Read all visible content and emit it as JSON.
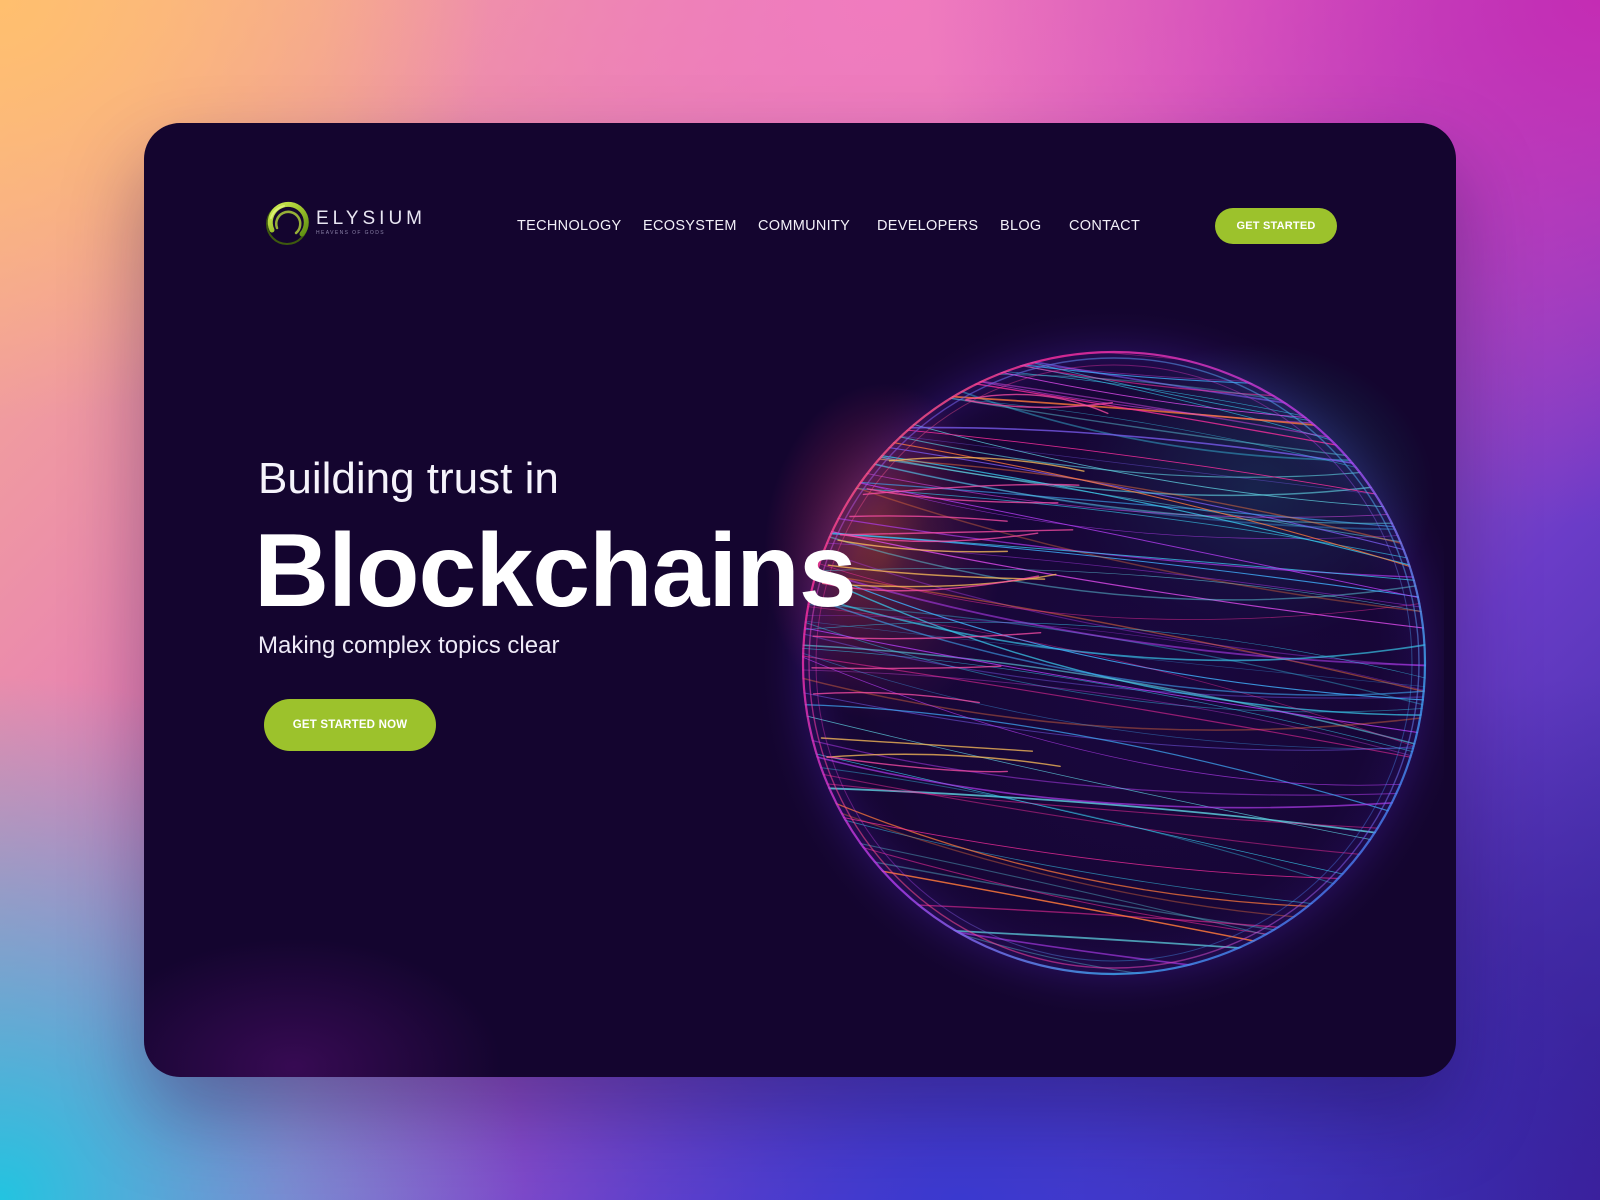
{
  "brand": {
    "name": "ELYSIUM",
    "tagline": "HEAVENS OF GODS",
    "accent_color": "#9cc22c"
  },
  "nav": {
    "items": [
      {
        "label": "TECHNOLOGY"
      },
      {
        "label": "ECOSYSTEM"
      },
      {
        "label": "COMMUNITY"
      },
      {
        "label": "DEVELOPERS"
      },
      {
        "label": "BLOG"
      },
      {
        "label": "CONTACT"
      }
    ],
    "cta_label": "GET STARTED"
  },
  "hero": {
    "pretitle": "Building trust in",
    "title": "Blockchains",
    "subtitle": "Making complex topics clear",
    "cta_label": "GET STARTED NOW"
  },
  "visual": {
    "icon": "wireframe-sphere"
  },
  "colors": {
    "card_background": "#14052f",
    "button": "#9cc22c"
  }
}
